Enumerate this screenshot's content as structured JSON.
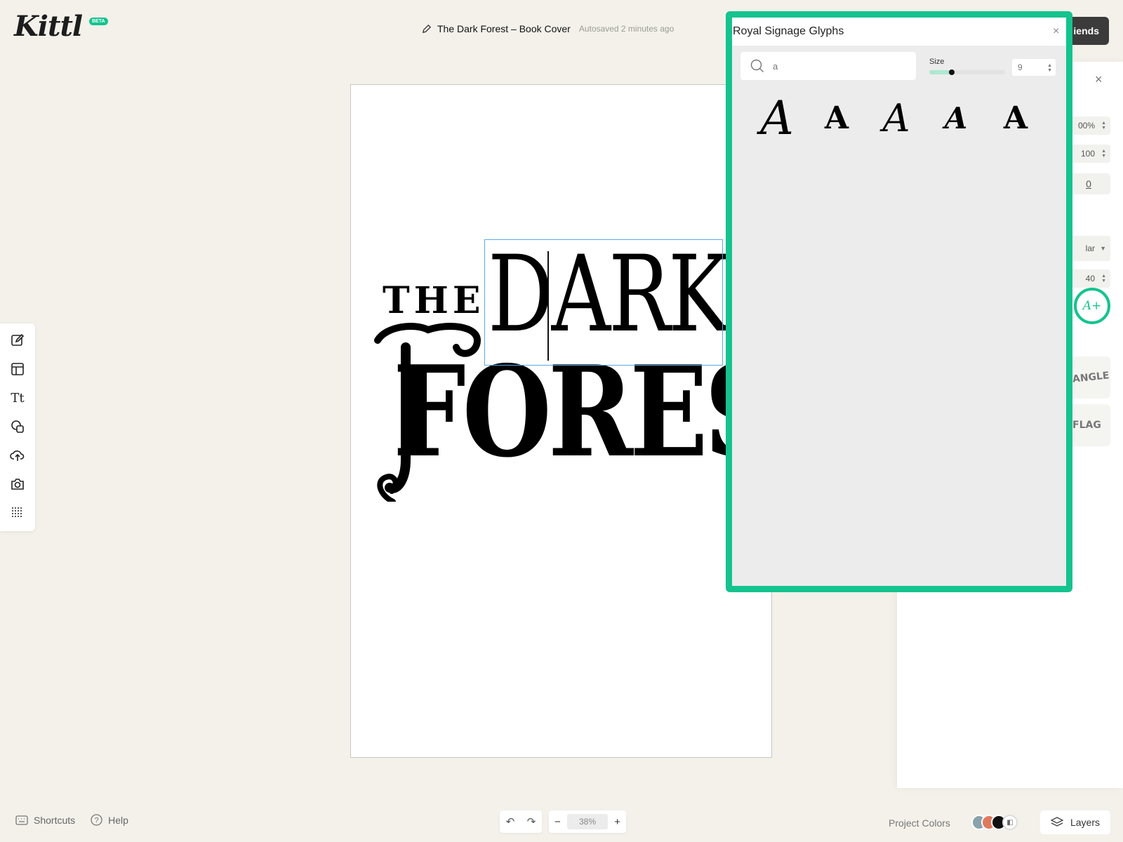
{
  "app": {
    "logo_text": "Kittl",
    "badge": "BETA"
  },
  "header": {
    "doc_title": "The Dark Forest – Book Cover",
    "autosave": "Autosaved 2 minutes ago",
    "share_label": "iends"
  },
  "canvas": {
    "line1": "THE",
    "line2": "DARK",
    "line3": "FOREST"
  },
  "toolbar": {
    "items": [
      {
        "name": "edit-tool-icon",
        "glyph": "✎"
      },
      {
        "name": "templates-tool-icon",
        "glyph": "▣"
      },
      {
        "name": "text-tool-icon",
        "glyph": "Tt"
      },
      {
        "name": "elements-tool-icon",
        "glyph": "◔"
      },
      {
        "name": "uploads-tool-icon",
        "glyph": "⇪"
      },
      {
        "name": "photos-tool-icon",
        "glyph": "◉"
      },
      {
        "name": "grid-tool-icon",
        "glyph": "⠿"
      }
    ]
  },
  "properties": {
    "field1": "00%",
    "field2": "100",
    "field3": "0",
    "font_weight_select": "lar",
    "field4": "40",
    "style_card1": "ANGLE",
    "style_card2": "FLAG"
  },
  "glyph_popup": {
    "title": "Royal Signage Glyphs",
    "search_placeholder": "a",
    "size_label": "Size",
    "size_value": "9",
    "size_slider_fraction": 0.3,
    "glyphs": [
      "A",
      "A",
      "A",
      "A",
      "A"
    ]
  },
  "bottom": {
    "shortcuts": "Shortcuts",
    "help": "Help",
    "zoom": "38%",
    "project_colors": "Project Colors",
    "layers": "Layers"
  },
  "colors": {
    "accent": "#14c38e",
    "swatches": [
      "#8aa2ab",
      "#e07a5f",
      "#111111",
      "#ffffff"
    ]
  }
}
